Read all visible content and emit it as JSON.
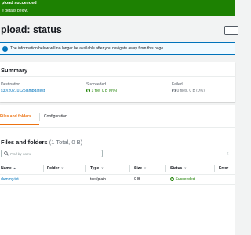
{
  "banner": {
    "title": "pload succeeded",
    "subtitle": "e details below."
  },
  "page": {
    "title": "pload: status"
  },
  "info": {
    "text": "The information below will no longer be available after you navigate away from this page."
  },
  "summary": {
    "title": "Summary",
    "destination_label": "Destination",
    "destination_value": "s3://20210125lambdatest",
    "succeeded_label": "Succeeded",
    "succeeded_value": "1 file, 0 B (0%)",
    "failed_label": "Failed",
    "failed_value": "0 files, 0 B (0%)"
  },
  "tabs": [
    {
      "label": "Files and folders"
    },
    {
      "label": "Configuration"
    }
  ],
  "files": {
    "title": "Files and folders",
    "count": "(1 Total, 0 B)",
    "search_placeholder": "Find by name",
    "columns": [
      "Name",
      "Folder",
      "Type",
      "Size",
      "Status",
      "Error"
    ],
    "rows": [
      {
        "name": "dummy.txt",
        "folder": "-",
        "type": "text/plain",
        "size": "0 B",
        "status": "Succeeded",
        "error": "-"
      }
    ]
  },
  "colors": {
    "success": "#1d8102",
    "link": "#0073bb",
    "accent": "#ec7211",
    "info_bg": "#f1faff"
  },
  "icons": [
    "success-check-icon",
    "info-icon",
    "fail-icon",
    "search-icon",
    "sort-icon",
    "chevron-left-icon"
  ]
}
